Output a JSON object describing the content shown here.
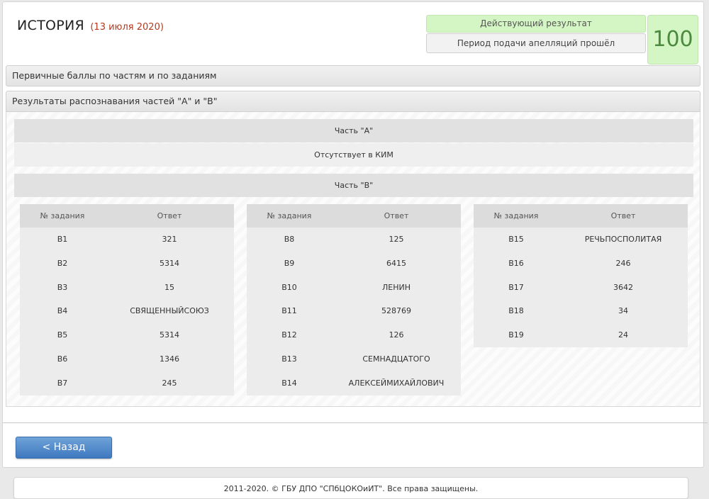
{
  "header": {
    "subject": "ИСТОРИЯ",
    "date": "(13 июля 2020)"
  },
  "status": {
    "current_result": "Действующий результат",
    "appeal_period": "Период подачи апелляций прошёл",
    "score": "100"
  },
  "sections": {
    "primary_scores": "Первичные баллы по частям и по заданиям",
    "recognition_results": "Результаты распознавания частей \"А\" и \"В\""
  },
  "part_a": {
    "title": "Часть \"А\"",
    "note": "Отсутствует в КИМ"
  },
  "part_b": {
    "title": "Часть \"В\"",
    "column_task": "№ задания",
    "column_answer": "Ответ",
    "tables": [
      [
        {
          "task": "В1",
          "answer": "321"
        },
        {
          "task": "В2",
          "answer": "5314"
        },
        {
          "task": "В3",
          "answer": "15"
        },
        {
          "task": "В4",
          "answer": "СВЯЩЕННЫЙСОЮЗ"
        },
        {
          "task": "В5",
          "answer": "5314"
        },
        {
          "task": "В6",
          "answer": "1346"
        },
        {
          "task": "В7",
          "answer": "245"
        }
      ],
      [
        {
          "task": "В8",
          "answer": "125"
        },
        {
          "task": "В9",
          "answer": "6415"
        },
        {
          "task": "В10",
          "answer": "ЛЕНИН"
        },
        {
          "task": "В11",
          "answer": "528769"
        },
        {
          "task": "В12",
          "answer": "126"
        },
        {
          "task": "В13",
          "answer": "СЕМНАДЦАТОГО"
        },
        {
          "task": "В14",
          "answer": "АЛЕКСЕЙМИХАЙЛОВИЧ"
        }
      ],
      [
        {
          "task": "В15",
          "answer": "РЕЧЬПОСПОЛИТАЯ"
        },
        {
          "task": "В16",
          "answer": "246"
        },
        {
          "task": "В17",
          "answer": "3642"
        },
        {
          "task": "В18",
          "answer": "34"
        },
        {
          "task": "В19",
          "answer": "24"
        }
      ]
    ]
  },
  "nav": {
    "back_label": "< Назад"
  },
  "footer": {
    "copyright": "2011-2020. © ГБУ ДПО \"СПбЦОКОиИТ\". Все права защищены."
  },
  "colors": {
    "accent_green": "#d4f5c4",
    "score_text": "#4b8a3f",
    "date_text": "#b23a1e",
    "button_blue": "#4a84c8"
  }
}
